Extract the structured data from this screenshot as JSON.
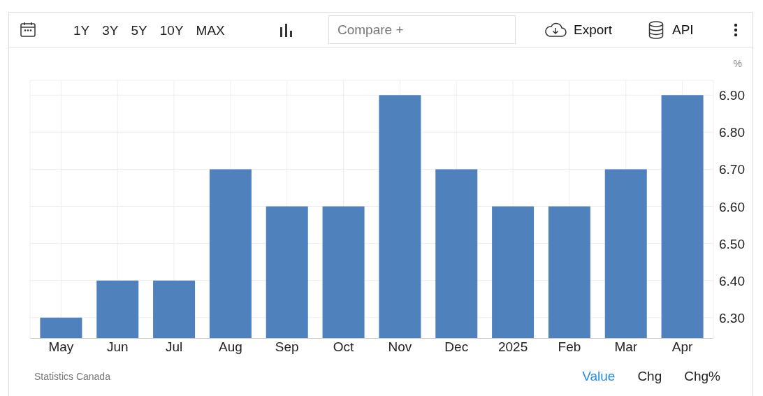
{
  "toolbar": {
    "ranges": [
      {
        "label": "1Y",
        "selected": false
      },
      {
        "label": "3Y",
        "selected": false
      },
      {
        "label": "5Y",
        "selected": false
      },
      {
        "label": "10Y",
        "selected": false
      },
      {
        "label": "MAX",
        "selected": false
      }
    ],
    "compare": {
      "placeholder": "Compare +"
    },
    "export": "Export",
    "api": "API"
  },
  "chart": {
    "unit": "%",
    "chart_data": {
      "type": "bar",
      "categories": [
        "May",
        "Jun",
        "Jul",
        "Aug",
        "Sep",
        "Oct",
        "Nov",
        "Dec",
        "2025",
        "Feb",
        "Mar",
        "Apr"
      ],
      "grid": true,
      "series": [
        {
          "color": "#4f81bd",
          "values": [
            6.3,
            6.4,
            6.4,
            6.7,
            6.6,
            6.6,
            6.9,
            6.7,
            6.6,
            6.6,
            6.7,
            6.9
          ]
        }
      ],
      "ylim": [
        6.245,
        6.94
      ],
      "yticks": [
        {
          "value": 6.3,
          "label": "6.30"
        },
        {
          "value": 6.4,
          "label": "6.40"
        },
        {
          "value": 6.5,
          "label": "6.50"
        },
        {
          "value": 6.6,
          "label": "6.60"
        },
        {
          "value": 6.7,
          "label": "6.70"
        },
        {
          "value": 6.8,
          "label": "6.80"
        },
        {
          "value": 6.9,
          "label": "6.90"
        }
      ]
    }
  },
  "footer": {
    "source": "Statistics Canada",
    "modes": [
      {
        "label": "Value",
        "selected": true
      },
      {
        "label": "Chg",
        "selected": false
      },
      {
        "label": "Chg%",
        "selected": false
      }
    ]
  }
}
